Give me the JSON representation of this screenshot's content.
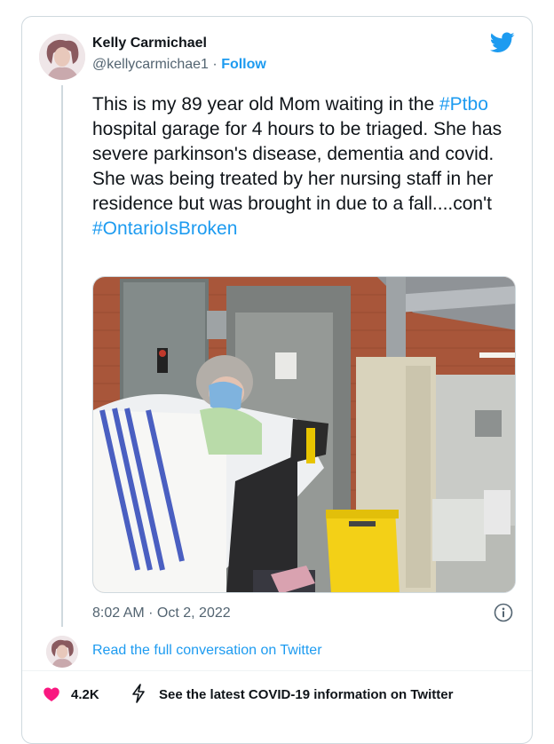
{
  "tweet": {
    "author_name": "Kelly Carmichael",
    "author_handle": "@kellycarmichae1",
    "separator": "·",
    "follow_label": "Follow",
    "text_line1_before": "This is my 89 year old Mom waiting in the",
    "text_tag1": "#Ptbo",
    "text_after_tag1": "hospital garage for 4 hours to be triaged. She has severe parkinson's disease, dementia and covid. She was being treated by her nursing staff in her residence but was brought in due to a fall....con't",
    "text_tag2": "#OntarioIsBroken",
    "timestamp": "8:02 AM · Oct 2, 2022",
    "read_more": "Read the full conversation on Twitter",
    "like_count": "4.2K",
    "covid_link": "See the latest COVID-19 information on Twitter"
  },
  "icons": {
    "brand": "twitter-bird-icon",
    "info": "info-icon",
    "like": "heart-icon",
    "covid": "bolt-icon"
  },
  "colors": {
    "link": "#1d9bf0",
    "text": "#0f1419",
    "muted": "#536471",
    "heart": "#f91880",
    "border": "#cfd9de"
  }
}
